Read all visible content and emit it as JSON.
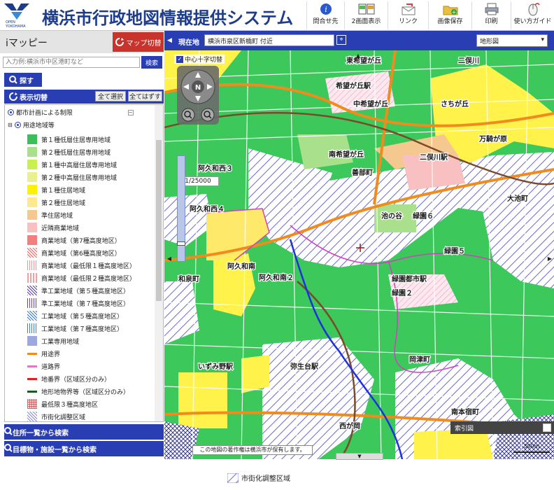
{
  "header": {
    "logo_text": "OPEN YOKOHAMA",
    "title": "横浜市行政地図情報提供システム",
    "toolbar": [
      {
        "label": "問合せ先",
        "icon": "info-icon"
      },
      {
        "label": "2画面表示",
        "icon": "split-screen-icon"
      },
      {
        "label": "リンク",
        "icon": "link-mail-icon"
      },
      {
        "label": "画像保存",
        "icon": "folder-save-icon"
      },
      {
        "label": "印刷",
        "icon": "printer-icon"
      },
      {
        "label": "使い方ガイド",
        "icon": "mouse-guide-icon"
      }
    ]
  },
  "sidebar": {
    "imap_label": "iマッピー",
    "switch_label": "マップ切替",
    "search_placeholder": "入力例:横浜市中区港町など",
    "search_button": "検索",
    "search_tab": "探す",
    "display_toggle": "表示切替",
    "select_all": "全て選択",
    "clear_all": "全てはずす",
    "group_title": "都市計画による制限",
    "subgroup_title": "用途地域等",
    "legend": [
      {
        "label": "第１種低層住居専用地域",
        "color": "#3dbe5a",
        "kind": "fill"
      },
      {
        "label": "第２種低層住居専用地域",
        "color": "#a8e08c",
        "kind": "fill"
      },
      {
        "label": "第１種中高層住居専用地域",
        "color": "#c8f050",
        "kind": "fill"
      },
      {
        "label": "第２種中高層住居専用地域",
        "color": "#e8f090",
        "kind": "fill"
      },
      {
        "label": "第１種住居地域",
        "color": "#fff200",
        "kind": "fill"
      },
      {
        "label": "第２種住居地域",
        "color": "#ffe890",
        "kind": "fill"
      },
      {
        "label": "準住居地域",
        "color": "#f5c890",
        "kind": "fill"
      },
      {
        "label": "近隣商業地域",
        "color": "#f8c0c0",
        "kind": "fill"
      },
      {
        "label": "商業地域（第7種高度地区）",
        "color": "#f08080",
        "kind": "fill"
      },
      {
        "label": "商業地域（第6種高度地区）",
        "color": "#f06060",
        "kind": "cross"
      },
      {
        "label": "商業地域（最低限１種高度地区）",
        "color": "#f09090",
        "kind": "vert"
      },
      {
        "label": "商業地域（最低限２種高度地区）",
        "color": "#f0a0a0",
        "kind": "vert2"
      },
      {
        "label": "準工業地域（第５種高度地区）",
        "color": "#5a3ca0",
        "kind": "cross"
      },
      {
        "label": "準工業地域（第７種高度地区）",
        "color": "#6a3ca0",
        "kind": "vert"
      },
      {
        "label": "工業地域（第５種高度地区）",
        "color": "#3a7ac8",
        "kind": "cross"
      },
      {
        "label": "工業地域（第７種高度地区）",
        "color": "#3a7ac8",
        "kind": "vert"
      },
      {
        "label": "工業専用地域",
        "color": "#9ea8e0",
        "kind": "fill"
      },
      {
        "label": "用途界",
        "color": "#f08c1e",
        "kind": "line"
      },
      {
        "label": "道路界",
        "color": "#e078c8",
        "kind": "line"
      },
      {
        "label": "地番界（区域区分のみ）",
        "color": "#e02020",
        "kind": "line"
      },
      {
        "label": "地形地物界等（区域区分のみ）",
        "color": "#1e5a1e",
        "kind": "line"
      },
      {
        "label": "最低限３種高度地区",
        "color": "#e06060",
        "kind": "grid"
      },
      {
        "label": "市街化調整区域",
        "color": "#8a8ad0",
        "kind": "hatch"
      }
    ],
    "address_search": "住所一覧から検索",
    "landmark_search": "目標物・施設一覧から検索"
  },
  "map": {
    "location_label": "現在地",
    "location_value": "横浜市泉区新橋町 付近",
    "base_map": "地形図",
    "crosshair_label": "中心十字切替",
    "nav_north": "N",
    "scale": "1/25000",
    "copyright": "この地図の著作権は横浜市が保有します。",
    "index_map": "索引図",
    "scalebar": "300m",
    "place_labels": [
      "東希望が丘",
      "希望が丘駅",
      "中希望が丘",
      "さちが丘",
      "南希望が丘",
      "善部町",
      "万騎が原",
      "二俣川駅",
      "二俣川",
      "阿久和西３",
      "阿久和西４",
      "和泉町",
      "池の谷",
      "緑園６",
      "緑園５",
      "緑園都市駅",
      "緑園２",
      "阿久和南",
      "阿久和南２",
      "いずみ野駅",
      "弥生台駅",
      "岡津町",
      "西が岡",
      "大池町",
      "南本宿町"
    ]
  },
  "footer": {
    "legend_label": "市街化調整区域"
  }
}
